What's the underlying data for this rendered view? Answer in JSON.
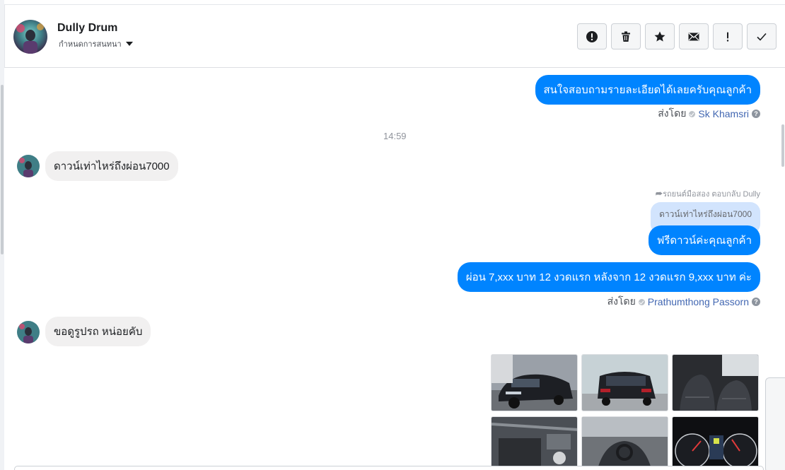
{
  "header": {
    "name": "Dully Drum",
    "subtitle": "กำหนดการสนทนา"
  },
  "actions": [
    {
      "icon": "alert-circle-icon",
      "label": "spam"
    },
    {
      "icon": "trash-icon",
      "label": "delete"
    },
    {
      "icon": "star-icon",
      "label": "star"
    },
    {
      "icon": "envelope-icon",
      "label": "mark unread"
    },
    {
      "icon": "exclamation-icon",
      "label": "follow up"
    },
    {
      "icon": "check-icon",
      "label": "done"
    }
  ],
  "messages": {
    "m1": "สนใจสอบถามรายละเอียดได้เลยครับคุณลูกค้า",
    "sent1_prefix": "ส่งโดย",
    "sent1_name": "Sk Khamsri",
    "time1": "14:59",
    "in1": "ดาวน์เท่าไหร่ถึงผ่อน7000",
    "reply_note": "รถยนต์มือสอง ตอบกลับ Dully",
    "quoted": "ดาวน์เท่าไหร่ถึงผ่อน7000",
    "m2": "ฟรีดาวน์ค่ะคุณลูกค้า",
    "m3": "ผ่อน 7,xxx บาท 12 งวดแรก หลังจาก 12 งวดแรก 9,xxx บาท ค่ะ",
    "sent2_prefix": "ส่งโดย",
    "sent2_name": "Prathumthong Passorn",
    "in2": "ขอดูรูปรถ หน่อยคับ"
  },
  "colors": {
    "outgoing": "#0084ff",
    "incoming": "#f1f0f0",
    "quote": "#d2e4fd",
    "link": "#4267b2"
  }
}
